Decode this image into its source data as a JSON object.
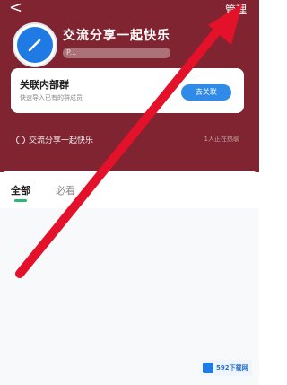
{
  "header": {
    "back_glyph": "<",
    "manage_label": "管理",
    "group_name": "交流分享一起快乐",
    "group_sub": "P..."
  },
  "link_card": {
    "title": "关联内部群",
    "desc": "快速导入已有的群成员",
    "button": "去关联"
  },
  "topic": {
    "label": "交流分享一起快乐",
    "status": "1人正在热聊"
  },
  "tabs": [
    {
      "label": "全部"
    },
    {
      "label": "必看"
    }
  ],
  "watermark": {
    "text": "592下载网"
  },
  "colors": {
    "header_bg": "#7f2430",
    "accent_blue": "#2f8ae8",
    "tab_underline": "#2bb673",
    "arrow": "#e3122a"
  }
}
